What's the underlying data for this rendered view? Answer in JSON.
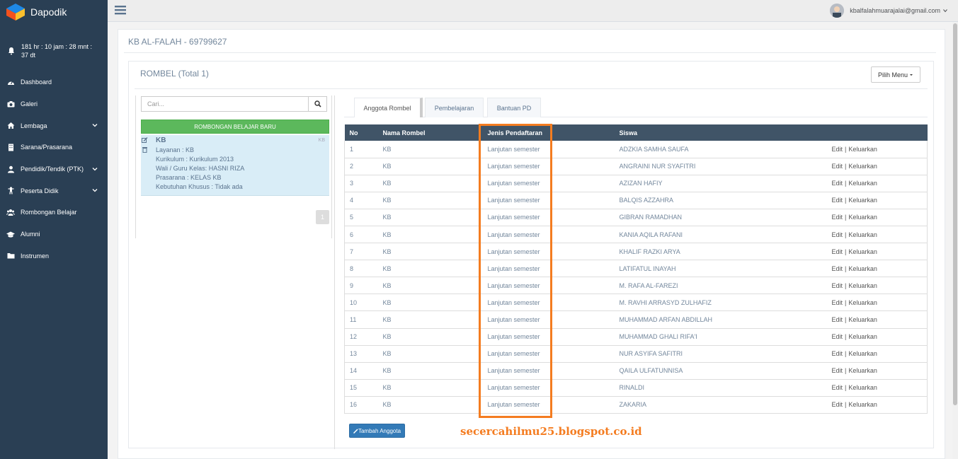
{
  "sidebar": {
    "brand": "Dapodik",
    "timer": "181 hr : 10 jam : 28 mnt : 37 dt",
    "items": [
      {
        "label": "Dashboard",
        "icon": "dashboard-icon",
        "has_submenu": false
      },
      {
        "label": "Galeri",
        "icon": "camera-icon",
        "has_submenu": false
      },
      {
        "label": "Lembaga",
        "icon": "home-icon",
        "has_submenu": true
      },
      {
        "label": "Sarana/Prasarana",
        "icon": "building-icon",
        "has_submenu": false
      },
      {
        "label": "Pendidik/Tendik (PTK)",
        "icon": "user-icon",
        "has_submenu": true
      },
      {
        "label": "Peserta Didik",
        "icon": "child-icon",
        "has_submenu": true
      },
      {
        "label": "Rombongan Belajar",
        "icon": "users-icon",
        "has_submenu": false
      },
      {
        "label": "Alumni",
        "icon": "graduation-cap-icon",
        "has_submenu": false
      },
      {
        "label": "Instrumen",
        "icon": "folder-icon",
        "has_submenu": false
      }
    ]
  },
  "topnav": {
    "user_email": "kbalfalahmuarajalai@gmail.com"
  },
  "page": {
    "title": "KB AL-FALAH - 69799627"
  },
  "panel": {
    "title": "ROMBEL (Total 1)",
    "pilih_menu": "Pilih Menu"
  },
  "left": {
    "search_placeholder": "Cari...",
    "new_button": "ROMBONGAN BELAJAR BARU",
    "rombel": {
      "name": "KB",
      "tag": "KB",
      "layanan": "Layanan : KB",
      "kurikulum": "Kurikulum : Kurikulum 2013",
      "wali": "Wali / Guru Kelas: HASNI RIZA",
      "prasarana": "Prasarana : KELAS KB",
      "kebutuhan": "Kebutuhan Khusus : Tidak ada"
    },
    "page_number": "1"
  },
  "tabs": [
    {
      "label": "Anggota Rombel",
      "active": true
    },
    {
      "label": "Pembelajaran",
      "active": false
    },
    {
      "label": "Bantuan PD",
      "active": false
    }
  ],
  "table": {
    "headers": [
      "No",
      "Nama Rombel",
      "Jenis Pendaftaran",
      "Siswa",
      ""
    ],
    "action_edit": "Edit",
    "action_sep": "|",
    "action_remove": "Keluarkan",
    "rows": [
      {
        "no": "1",
        "rombel": "KB",
        "jenis": "Lanjutan semester",
        "siswa": "ADZKIA SAMHA SAUFA"
      },
      {
        "no": "2",
        "rombel": "KB",
        "jenis": "Lanjutan semester",
        "siswa": "ANGRAINI NUR SYAFITRI"
      },
      {
        "no": "3",
        "rombel": "KB",
        "jenis": "Lanjutan semester",
        "siswa": "AZIZAN HAFIY"
      },
      {
        "no": "4",
        "rombel": "KB",
        "jenis": "Lanjutan semester",
        "siswa": "BALQIS AZZAHRA"
      },
      {
        "no": "5",
        "rombel": "KB",
        "jenis": "Lanjutan semester",
        "siswa": "GIBRAN RAMADHAN"
      },
      {
        "no": "6",
        "rombel": "KB",
        "jenis": "Lanjutan semester",
        "siswa": "KANIA AQILA RAFANI"
      },
      {
        "no": "7",
        "rombel": "KB",
        "jenis": "Lanjutan semester",
        "siswa": "KHALIF RAZKI ARYA"
      },
      {
        "no": "8",
        "rombel": "KB",
        "jenis": "Lanjutan semester",
        "siswa": "LATIFATUL INAYAH"
      },
      {
        "no": "9",
        "rombel": "KB",
        "jenis": "Lanjutan semester",
        "siswa": "M. RAFA AL-FAREZI"
      },
      {
        "no": "10",
        "rombel": "KB",
        "jenis": "Lanjutan semester",
        "siswa": "M. RAVHI ARRASYD ZULHAFIZ"
      },
      {
        "no": "11",
        "rombel": "KB",
        "jenis": "Lanjutan semester",
        "siswa": "MUHAMMAD ARFAN ABDILLAH"
      },
      {
        "no": "12",
        "rombel": "KB",
        "jenis": "Lanjutan semester",
        "siswa": "MUHAMMAD GHALI RIFA'I"
      },
      {
        "no": "13",
        "rombel": "KB",
        "jenis": "Lanjutan semester",
        "siswa": "NUR ASYIFA SAFITRI"
      },
      {
        "no": "14",
        "rombel": "KB",
        "jenis": "Lanjutan semester",
        "siswa": "QAILA ULFATUNNISA"
      },
      {
        "no": "15",
        "rombel": "KB",
        "jenis": "Lanjutan semester",
        "siswa": "RINALDI"
      },
      {
        "no": "16",
        "rombel": "KB",
        "jenis": "Lanjutan semester",
        "siswa": "ZAKARIA"
      }
    ]
  },
  "add_member_button": "Tambah Anggota",
  "watermark": "secercahilmu25.blogspot.co.id",
  "colors": {
    "sidebar": "#2a3f54",
    "table_header": "#405467",
    "highlight": "#f47c20",
    "success": "#5cb85c",
    "primary": "#337ab7"
  }
}
